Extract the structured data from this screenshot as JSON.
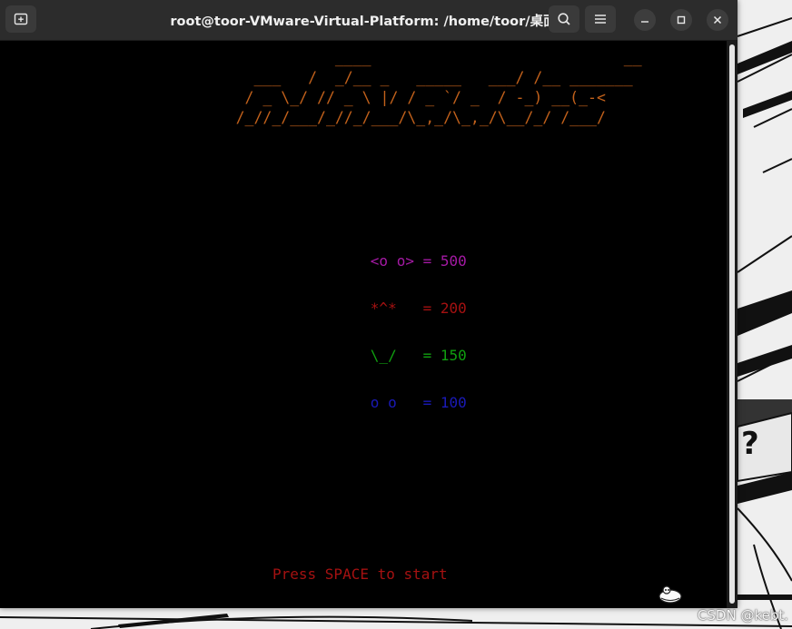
{
  "window": {
    "title": "root@toor-VMware-Virtual-Platform: /home/toor/桌面"
  },
  "titlebar_icons": {
    "new_tab": "new-tab-icon",
    "search": "search-icon",
    "menu": "hamburger-menu-icon",
    "minimize": "minimize-icon",
    "maximize": "maximize-icon",
    "close": "close-icon"
  },
  "game": {
    "logo_lines": [
      "                 ____                            __",
      "        ___   /  _/__ _   _____   ___/ /__ _______",
      "       / _ \\_/ // _ \\ |/ / _ `/ _  / -_) __(_-<",
      "      /_//_/___/_//_/___/\\_,_/\\_,_/\\__/_/ /___/"
    ],
    "scores": [
      {
        "alien": "<o o>",
        "points": "= 500",
        "color": "#a51aa5"
      },
      {
        "alien": "*^*  ",
        "points": "= 200",
        "color": "#a51111"
      },
      {
        "alien": "\\_/  ",
        "points": "= 150",
        "color": "#10a010"
      },
      {
        "alien": "o o  ",
        "points": "= 100",
        "color": "#1a1ab8"
      }
    ],
    "prompt": "Press SPACE to start"
  },
  "watermark": "CSDN @kebt.",
  "colors": {
    "logo": "#c2611b",
    "terminal_bg": "#000000",
    "titlebar_bg": "#2c2c2c"
  }
}
